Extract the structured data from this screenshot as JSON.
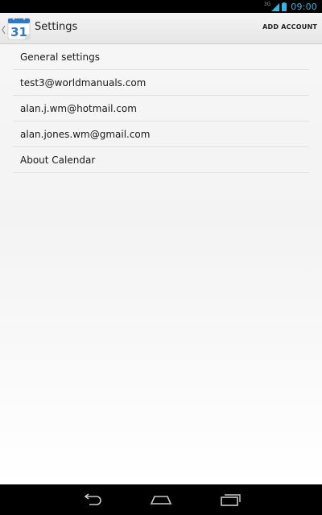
{
  "status_bar": {
    "network_type": "3G",
    "time": "09:00",
    "icons": [
      "signal-icon",
      "battery-icon"
    ],
    "accent_color": "#33b5e5"
  },
  "action_bar": {
    "app_icon": "calendar-icon",
    "app_icon_day": "31",
    "title": "Settings",
    "action_label": "ADD ACCOUNT"
  },
  "settings_list": {
    "items": [
      {
        "label": "General settings"
      },
      {
        "label": "test3@worldmanuals.com"
      },
      {
        "label": "alan.j.wm@hotmail.com"
      },
      {
        "label": "alan.jones.wm@gmail.com"
      },
      {
        "label": "About Calendar"
      }
    ]
  },
  "nav_bar": {
    "buttons": [
      "back-icon",
      "home-icon",
      "recent-apps-icon"
    ]
  }
}
